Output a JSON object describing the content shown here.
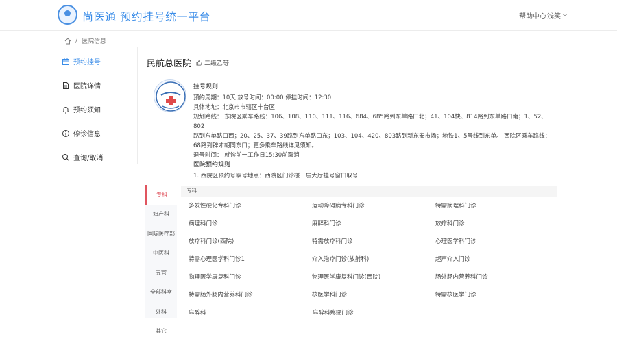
{
  "header": {
    "title": "尚医通 预约挂号统一平台",
    "help": "帮助中心",
    "user": "浅笑"
  },
  "breadcrumb": {
    "current": "医院信息"
  },
  "sidebar": {
    "items": [
      {
        "label": "预约挂号",
        "icon": "calendar-icon"
      },
      {
        "label": "医院详情",
        "icon": "document-icon"
      },
      {
        "label": "预约须知",
        "icon": "bell-icon"
      },
      {
        "label": "停诊信息",
        "icon": "info-icon"
      },
      {
        "label": "查询/取消",
        "icon": "search-icon"
      }
    ]
  },
  "hospital": {
    "name": "民航总医院",
    "level": "二级乙等"
  },
  "rules": {
    "title": "挂号规则",
    "cycle_line": "预约周期：10天  放号时间：00:00  停挂时间：12:30",
    "address_line": "具体地址：北京市市辖区丰台区",
    "route_line1": "规划路线：  东院区乘车路线：106、108、110、111、116、684、685路到东单路口北；41、104快、814路到东单路口南；1、52、802",
    "route_line2": "路到东单路口西；20、25、37、39路到东单路口东；103、104、420、803路到新东安市场；地铁1、5号线到东单。 西院区乘车路线：",
    "route_line3": "68路到辟才胡同东口；更多乘车路线详见须知。",
    "quit_line": "退号时间：  就诊前一工作日15:30前取消",
    "booking_title": "医院预约规则",
    "booking_rule": "1. 西院区预约号取号地点：西院区门诊楼一层大厅挂号窗口取号"
  },
  "departments": {
    "tabs": [
      "专科",
      "妇产科",
      "国际医疗部",
      "中医科",
      "五官",
      "全部科室",
      "外科",
      "其它"
    ],
    "section_title": "专科",
    "rows": [
      [
        "多发性硬化专科门诊",
        "运动障碍病专科门诊",
        "特需病理科门诊"
      ],
      [
        "病理科门诊",
        "麻醉科门诊",
        "放疗科门诊"
      ],
      [
        "放疗科门诊(西院)",
        "特需放疗科门诊",
        "心理医学科门诊"
      ],
      [
        "特需心理医学科门诊1",
        "介入治疗门诊(放射科)",
        "超声介入门诊"
      ],
      [
        "物理医学康复科门诊",
        "物理医学康复科门诊(西院)",
        "肠外肠内营养科门诊"
      ],
      [
        "特需肠外肠内营养科门诊",
        "核医学科门诊",
        "特需核医学门诊"
      ],
      [
        "麻醉科",
        "麻醉科疼痛门诊",
        ""
      ]
    ]
  },
  "colors": {
    "brand": "#3b8de8",
    "active_tab": "#e0555f"
  }
}
